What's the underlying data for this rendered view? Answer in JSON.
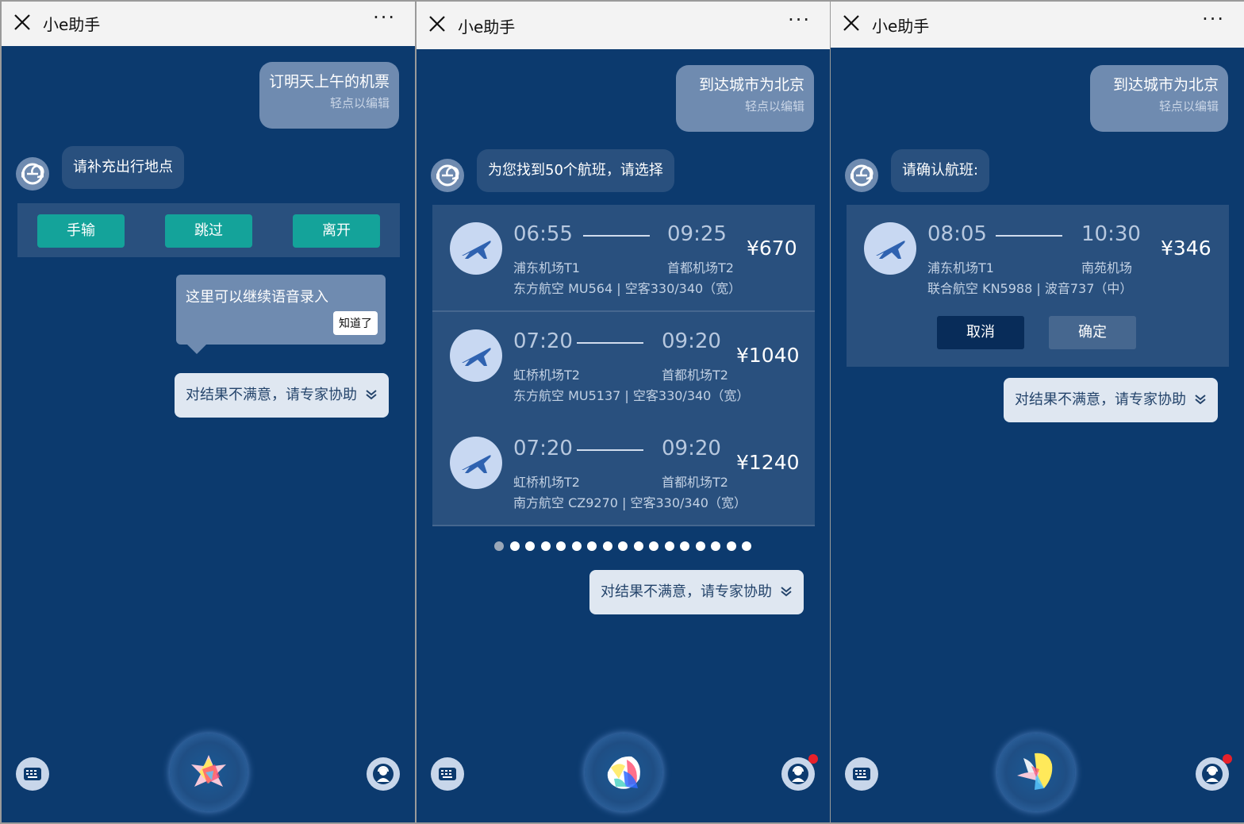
{
  "app": {
    "title": "小e助手",
    "more": "···"
  },
  "common": {
    "expert_label": "对结果不满意，请专家协助",
    "edit_hint": "轻点以编辑"
  },
  "screen1": {
    "user_message": "订明天上午的机票",
    "bot_message": "请补充出行地点",
    "actions": [
      "手输",
      "跳过",
      "离开"
    ],
    "tip_text": "这里可以继续语音录入",
    "tip_button": "知道了"
  },
  "screen2": {
    "user_message": "到达城市为北京",
    "bot_message": "为您找到50个航班，请选择",
    "flights": [
      {
        "dep_time": "06:55",
        "arr_time": "09:25",
        "dep_airport": "浦东机场T1",
        "arr_airport": "首都机场T2",
        "info": "东方航空 MU564 | 空客330/340（宽）",
        "price": "¥670"
      },
      {
        "dep_time": "07:20",
        "arr_time": "09:20",
        "dep_airport": "虹桥机场T2",
        "arr_airport": "首都机场T2",
        "info": "东方航空 MU5137 | 空客330/340（宽）",
        "price": "¥1040"
      },
      {
        "dep_time": "07:20",
        "arr_time": "09:20",
        "dep_airport": "虹桥机场T2",
        "arr_airport": "首都机场T2",
        "info": "南方航空 CZ9270 | 空客330/340（宽）",
        "price": "¥1240"
      }
    ],
    "page_count": 17,
    "current_page": 1,
    "agent_notification": true
  },
  "screen3": {
    "user_message": "到达城市为北京",
    "bot_message": "请确认航班:",
    "flight": {
      "dep_time": "08:05",
      "arr_time": "10:30",
      "dep_airport": "浦东机场T1",
      "arr_airport": "南苑机场",
      "info": "联合航空 KN5988 | 波音737（中）",
      "price": "¥346"
    },
    "cancel_label": "取消",
    "confirm_label": "确定",
    "agent_notification": true
  },
  "colors": {
    "background": "#0c3a6e",
    "card": "#29507e",
    "user_bubble": "#6f8bb0",
    "action_green": "#14a39a",
    "header": "#f3f3f3"
  },
  "icons": {
    "close": "close-icon",
    "more": "more-icon",
    "bot_avatar": "assistant-avatar-icon",
    "plane": "airplane-icon",
    "keyboard": "keyboard-icon",
    "voice": "voice-orb-icon",
    "agent": "customer-service-icon",
    "expand": "chevron-double-down-icon"
  }
}
